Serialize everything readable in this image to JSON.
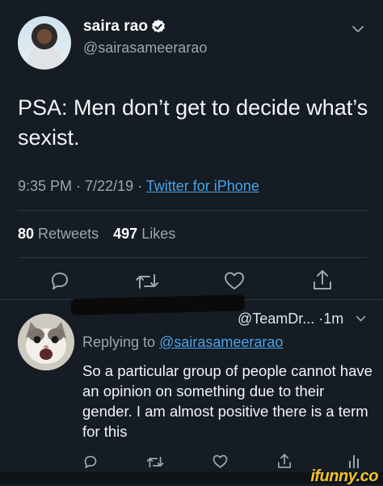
{
  "tweet": {
    "author_name": "saira rao",
    "author_handle": "@sairasameerarao",
    "text": "PSA: Men don’t get to decide what’s sexist.",
    "time_date": "9:35 PM · 7/22/19 · ",
    "client": "Twitter for iPhone",
    "retweets_count": "80",
    "retweets_label": "Retweets",
    "likes_count": "497",
    "likes_label": "Likes"
  },
  "reply": {
    "handle_time": "@TeamDr... ·1m",
    "replying_prefix": "Replying to ",
    "replying_to": "@sairasameerarao",
    "text": "So a particular group of people cannot have an opinion on something due to their gender. I am almost positive there is a term for this"
  },
  "watermark": {
    "text": "ifunny.co",
    "color": "#f5c22b"
  },
  "colors": {
    "background": "#151c23",
    "link": "#4aa3e8",
    "secondary_text": "#9aa6b1",
    "verified": "#ffffff"
  },
  "icons": {
    "verified": "verified-badge-icon",
    "reply": "reply-icon",
    "retweet": "retweet-icon",
    "like": "heart-icon",
    "share": "share-icon",
    "menu": "chevron-down-icon"
  }
}
